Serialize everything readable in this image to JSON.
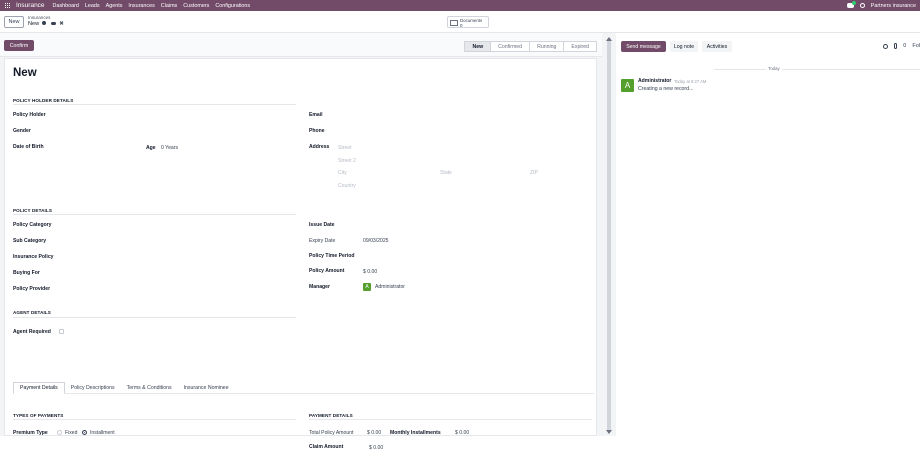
{
  "topnav": {
    "brand": "Insurance",
    "menu": [
      "Dashboard",
      "Leads",
      "Agents",
      "Insurances",
      "Claims",
      "Customers",
      "Configurations"
    ],
    "company": "Partners insurance"
  },
  "control": {
    "new_label": "New",
    "breadcrumb_parent": "Insurances",
    "breadcrumb_current": "New",
    "documents_label": "Documents",
    "documents_count": "0"
  },
  "status": {
    "confirm_label": "Confirm",
    "stages": [
      "New",
      "Confirmed",
      "Running",
      "Expired"
    ],
    "active_stage": "New"
  },
  "form": {
    "title": "New",
    "policy_holder_section": "POLICY HOLDER DETAILS",
    "policy_holder_label": "Policy Holder",
    "gender_label": "Gender",
    "dob_label": "Date of Birth",
    "age_label": "Age",
    "age_value": "0 Years",
    "email_label": "Email",
    "phone_label": "Phone",
    "address_label": "Address",
    "address_placeholders": {
      "street": "Street",
      "street2": "Street 2",
      "city": "City",
      "state": "State",
      "zip": "ZIP",
      "country": "Country"
    },
    "policy_section": "POLICY DETAILS",
    "policy_category_label": "Policy Category",
    "sub_category_label": "Sub Category",
    "insurance_policy_label": "Insurance Policy",
    "buying_for_label": "Buying For",
    "policy_provider_label": "Policy Provider",
    "issue_date_label": "Issue Date",
    "expiry_date_label": "Expiry Date",
    "expiry_date_value": "09/03/2025",
    "policy_time_period_label": "Policy Time Period",
    "policy_amount_label": "Policy Amount",
    "policy_amount_value": "$ 0.00",
    "manager_label": "Manager",
    "manager_initial": "A",
    "manager_value": "Administrator",
    "agent_section": "AGENT DETAILS",
    "agent_required_label": "Agent Required",
    "tabs": [
      "Payment Details",
      "Policy Descriptions",
      "Terms & Conditions",
      "Insurance Nominee"
    ],
    "active_tab": "Payment Details",
    "types_section": "TYPES OF PAYMENTS",
    "premium_type_label": "Premium Type",
    "premium_options": [
      "Fixed",
      "Installment"
    ],
    "premium_selected": "Installment",
    "payment_section": "PAYMENT DETAILS",
    "total_policy_amount_label": "Total Policy Amount",
    "total_policy_amount_value": "$ 0.00",
    "monthly_installments_label": "Monthly Installments",
    "monthly_installments_value": "$ 0.00",
    "claim_amount_label": "Claim Amount",
    "claim_amount_value": "$ 0.00"
  },
  "chatter": {
    "send_message": "Send message",
    "log_note": "Log note",
    "activities": "Activities",
    "followers_count": "0",
    "follow_label": "Fol",
    "today": "Today",
    "message": {
      "avatar": "A",
      "author": "Administrator",
      "time": "Today at 6:27 AM",
      "body": "Creating a new record..."
    }
  }
}
